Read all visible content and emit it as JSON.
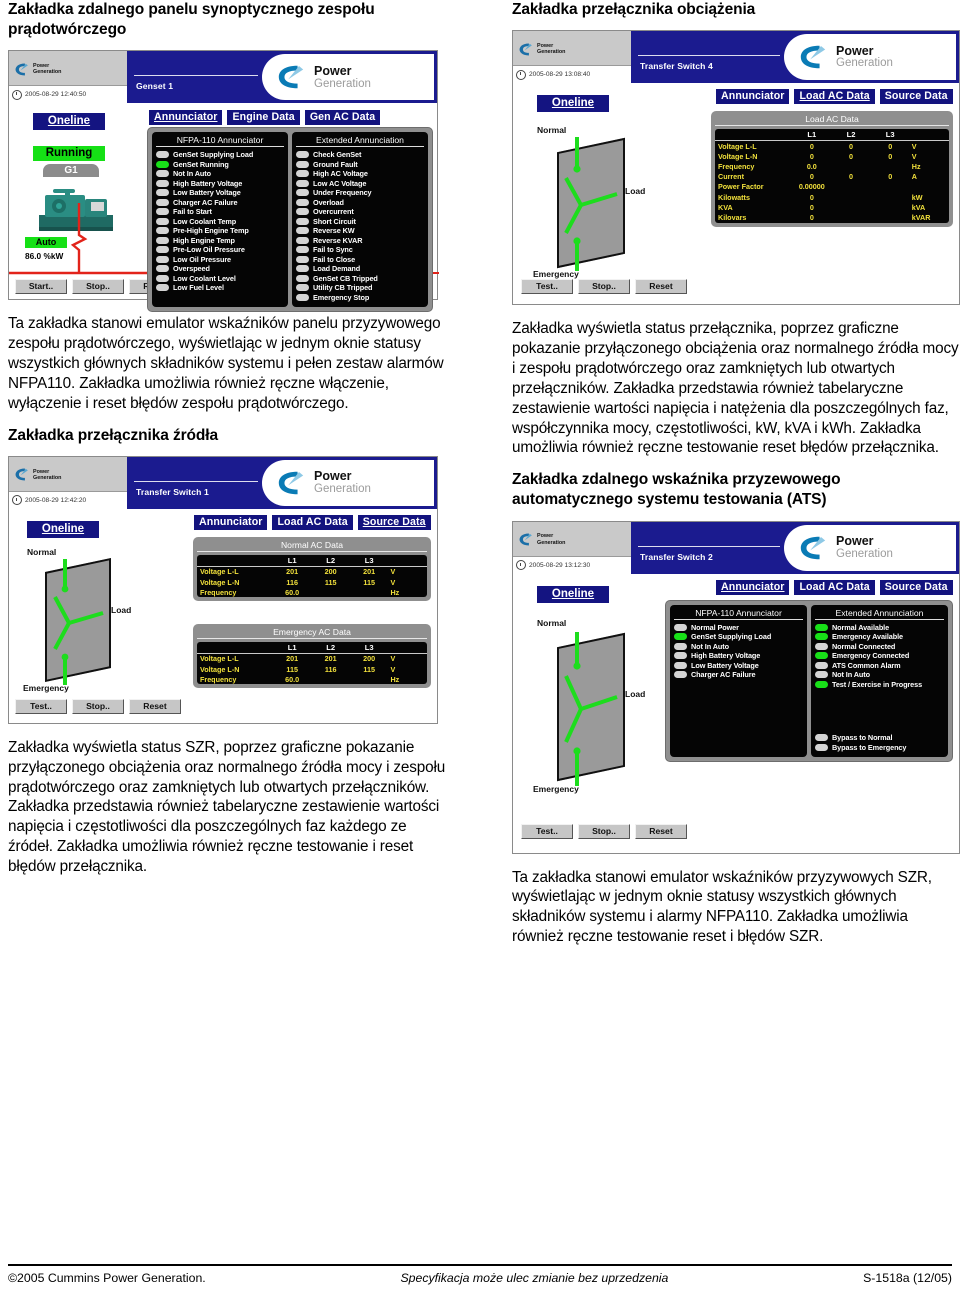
{
  "document": {
    "footer": {
      "copyright": "©2005 Cummins Power Generation.",
      "notice": "Specyfikacja może ulec zmianie bez uprzedzenia",
      "docid": "S-1518a (12/05)"
    }
  },
  "brand": {
    "name_top": "Power",
    "name_bottom": "Generation",
    "logo_small_line1": "Power",
    "logo_small_line2": "Generation"
  },
  "sections": {
    "genset_panel": {
      "heading": "Zakładka zdalnego panelu synoptycznego zespołu prądotwórczego",
      "body": "Ta zakładka stanowi emulator wskaźników panelu przyzywowego zespołu prądotwórczego, wyświetlając w jednym oknie statusy wszystkich głównych składników systemu i pełen zestaw alarmów NFPA110. Zakładka umożliwia również ręczne włączenie, wyłączenie i reset błędów zespołu prądotwórczego."
    },
    "source_switch": {
      "heading": "Zakładka przełącznika źródła",
      "body": "Zakładka wyświetla status SZR, poprzez graficzne pokazanie przyłączonego obciążenia oraz normalnego źródła mocy i zespołu prądotwórczego oraz zamkniętych lub otwartych przełączników. Zakładka przedstawia również tabelaryczne zestawienie wartości napięcia i częstotliwości dla poszczególnych faz każdego ze źródeł. Zakładka umożliwia również ręczne testowanie i reset błędów przełącznika."
    },
    "load_switch": {
      "heading": "Zakładka przełącznika obciążenia",
      "body": "Zakładka wyświetla status przełącznika, poprzez graficzne pokazanie przyłączonego obciążenia oraz normalnego źródła mocy i zespołu prądotwórczego oraz zamkniętych lub otwartych przełączników. Zakładka przedstawia również tabelaryczne zestawienie wartości napięcia i natężenia dla poszczególnych faz, współczynnika mocy, częstotliwości, kW, kVA i kWh. Zakładka umożliwia również ręczne testowanie reset błędów przełącznika."
    },
    "ats_panel": {
      "heading": "Zakładka zdalnego wskaźnika przyzewowego automatycznego systemu testowania (ATS)",
      "body": "Ta zakładka stanowi emulator wskaźników przyzywowych SZR, wyświetlając w jednym oknie statusy wszystkich głównych składników systemu i alarmy NFPA110. Zakładka umożliwia również ręczne testowanie reset i błędów SZR."
    }
  },
  "screenshot_genset": {
    "timestamp": "2005-08-29 12:40:50",
    "device": "Genset 1",
    "tabs": [
      {
        "label": "Annunciator",
        "active": true
      },
      {
        "label": "Engine Data",
        "active": false
      },
      {
        "label": "Gen AC Data",
        "active": false
      }
    ],
    "oneline_button": "Oneline",
    "status_running": "Running",
    "genset_tag": "G1",
    "mode": "Auto",
    "load_kw": "86.0 %kW",
    "buttons": [
      "Start..",
      "Stop..",
      "Reset"
    ],
    "annunciator": {
      "left_title": "NFPA-110 Annunciator",
      "right_title": "Extended Annunciation",
      "left_items": [
        {
          "label": "GenSet Supplying Load",
          "on": false
        },
        {
          "label": "GenSet Running",
          "on": true
        },
        {
          "label": "Not In Auto",
          "on": false
        },
        {
          "label": "High Battery Voltage",
          "on": false
        },
        {
          "label": "Low Battery Voltage",
          "on": false
        },
        {
          "label": "Charger AC Failure",
          "on": false
        },
        {
          "label": "Fail to Start",
          "on": false
        },
        {
          "label": "Low Coolant Temp",
          "on": false
        },
        {
          "label": "Pre-High Engine Temp",
          "on": false
        },
        {
          "label": "High Engine Temp",
          "on": false
        },
        {
          "label": "Pre-Low Oil Pressure",
          "on": false
        },
        {
          "label": "Low Oil Pressure",
          "on": false
        },
        {
          "label": "Overspeed",
          "on": false
        },
        {
          "label": "Low Coolant Level",
          "on": false
        },
        {
          "label": "Low Fuel Level",
          "on": false
        }
      ],
      "right_items": [
        {
          "label": "Check GenSet",
          "on": false
        },
        {
          "label": "Ground Fault",
          "on": false
        },
        {
          "label": "High AC Voltage",
          "on": false
        },
        {
          "label": "Low AC Voltage",
          "on": false
        },
        {
          "label": "Under Frequency",
          "on": false
        },
        {
          "label": "Overload",
          "on": false
        },
        {
          "label": "Overcurrent",
          "on": false
        },
        {
          "label": "Short Circuit",
          "on": false
        },
        {
          "label": "Reverse KW",
          "on": false
        },
        {
          "label": "Reverse KVAR",
          "on": false
        },
        {
          "label": "Fail to Sync",
          "on": false
        },
        {
          "label": "Fail to Close",
          "on": false
        },
        {
          "label": "Load Demand",
          "on": false
        },
        {
          "label": "GenSet CB Tripped",
          "on": false
        },
        {
          "label": "Utility CB Tripped",
          "on": false
        },
        {
          "label": "Emergency Stop",
          "on": false
        }
      ]
    }
  },
  "screenshot_load_switch": {
    "timestamp": "2005-08-29 13:08:40",
    "device": "Transfer Switch 4",
    "tabs": [
      {
        "label": "Annunciator",
        "active": false
      },
      {
        "label": "Load AC Data",
        "active": true
      },
      {
        "label": "Source Data",
        "active": false
      }
    ],
    "oneline_button": "Oneline",
    "diagram": {
      "normal": "Normal",
      "load": "Load",
      "emergency": "Emergency"
    },
    "buttons": [
      "Test..",
      "Stop..",
      "Reset"
    ],
    "table": {
      "title": "Load AC Data",
      "columns": [
        "",
        "L1",
        "L2",
        "L3",
        ""
      ],
      "rows": [
        {
          "label": "Voltage L-L",
          "l1": "0",
          "l2": "0",
          "l3": "0",
          "unit": "V"
        },
        {
          "label": "Voltage L-N",
          "l1": "0",
          "l2": "0",
          "l3": "0",
          "unit": "V"
        },
        {
          "label": "Frequency",
          "l1": "0.0",
          "l2": "",
          "l3": "",
          "unit": "Hz"
        },
        {
          "label": "Current",
          "l1": "0",
          "l2": "0",
          "l3": "0",
          "unit": "A"
        },
        {
          "label": "Power Factor",
          "l1": "0.00000",
          "l2": "",
          "l3": "",
          "unit": ""
        },
        {
          "label": "Kilowatts",
          "l1": "0",
          "l2": "",
          "l3": "",
          "unit": "kW"
        },
        {
          "label": "KVA",
          "l1": "0",
          "l2": "",
          "l3": "",
          "unit": "kVA"
        },
        {
          "label": "Kilovars",
          "l1": "0",
          "l2": "",
          "l3": "",
          "unit": "kVAR"
        }
      ]
    }
  },
  "screenshot_source_switch": {
    "timestamp": "2005-08-29 12:42:20",
    "device": "Transfer Switch 1",
    "tabs": [
      {
        "label": "Annunciator",
        "active": false
      },
      {
        "label": "Load AC Data",
        "active": false
      },
      {
        "label": "Source Data",
        "active": true
      }
    ],
    "oneline_button": "Oneline",
    "diagram": {
      "normal": "Normal",
      "load": "Load",
      "emergency": "Emergency"
    },
    "buttons": [
      "Test..",
      "Stop..",
      "Reset"
    ],
    "normal_table": {
      "title": "Normal AC Data",
      "columns": [
        "",
        "L1",
        "L2",
        "L3",
        ""
      ],
      "rows": [
        {
          "label": "Voltage L-L",
          "l1": "201",
          "l2": "200",
          "l3": "201",
          "unit": "V"
        },
        {
          "label": "Voltage L-N",
          "l1": "116",
          "l2": "115",
          "l3": "115",
          "unit": "V"
        },
        {
          "label": "Frequency",
          "l1": "60.0",
          "l2": "",
          "l3": "",
          "unit": "Hz"
        }
      ]
    },
    "emergency_table": {
      "title": "Emergency AC Data",
      "columns": [
        "",
        "L1",
        "L2",
        "L3",
        ""
      ],
      "rows": [
        {
          "label": "Voltage L-L",
          "l1": "201",
          "l2": "201",
          "l3": "200",
          "unit": "V"
        },
        {
          "label": "Voltage L-N",
          "l1": "115",
          "l2": "116",
          "l3": "115",
          "unit": "V"
        },
        {
          "label": "Frequency",
          "l1": "60.0",
          "l2": "",
          "l3": "",
          "unit": "Hz"
        }
      ]
    }
  },
  "screenshot_ats": {
    "timestamp": "2005-08-29 13:12:30",
    "device": "Transfer Switch 2",
    "tabs": [
      {
        "label": "Annunciator",
        "active": true
      },
      {
        "label": "Load AC Data",
        "active": false
      },
      {
        "label": "Source Data",
        "active": false
      }
    ],
    "oneline_button": "Oneline",
    "diagram": {
      "normal": "Normal",
      "load": "Load",
      "emergency": "Emergency"
    },
    "buttons": [
      "Test..",
      "Stop..",
      "Reset"
    ],
    "annunciator": {
      "left_title": "NFPA-110 Annunciator",
      "right_title": "Extended Annunciation",
      "left_items": [
        {
          "label": "Normal Power",
          "on": false
        },
        {
          "label": "GenSet Supplying Load",
          "on": true
        },
        {
          "label": "Not In Auto",
          "on": false
        },
        {
          "label": "High Battery Voltage",
          "on": false
        },
        {
          "label": "Low Battery Voltage",
          "on": false
        },
        {
          "label": "Charger AC Failure",
          "on": false
        }
      ],
      "right_items": [
        {
          "label": "Normal Available",
          "on": true
        },
        {
          "label": "Emergency Available",
          "on": true
        },
        {
          "label": "Normal Connected",
          "on": false
        },
        {
          "label": "Emergency Connected",
          "on": true
        },
        {
          "label": "ATS Common Alarm",
          "on": false
        },
        {
          "label": "Not In Auto",
          "on": false
        },
        {
          "label": "Test / Exercise in Progress",
          "on": true
        }
      ],
      "bypass_items": [
        {
          "label": "Bypass to Normal",
          "on": false
        },
        {
          "label": "Bypass to Emergency",
          "on": false
        }
      ]
    }
  },
  "colors": {
    "titlebar_blue": "#1b1b8f",
    "tab_blue": "#13137e",
    "led_on_green": "#18e018",
    "led_off_gray": "#d4d4d4",
    "table_value_yellow": "#f2e13c",
    "wire_red": "#e2231a",
    "panel_gray": "#8f8f8f"
  }
}
